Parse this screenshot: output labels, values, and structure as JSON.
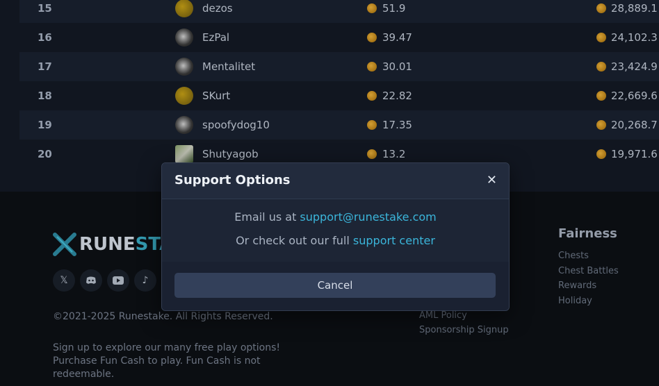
{
  "leaderboard": {
    "rows": [
      {
        "rank": "15",
        "user": "dezos",
        "wagered": "51.9",
        "prize": "28,889.1"
      },
      {
        "rank": "16",
        "user": "EzPal",
        "wagered": "39.47",
        "prize": "24,102.3"
      },
      {
        "rank": "17",
        "user": "Mentalitet",
        "wagered": "30.01",
        "prize": "23,424.9"
      },
      {
        "rank": "18",
        "user": "SKurt",
        "wagered": "22.82",
        "prize": "22,669.6"
      },
      {
        "rank": "19",
        "user": "spoofydog10",
        "wagered": "17.35",
        "prize": "20,268.7"
      },
      {
        "rank": "20",
        "user": "Shutyagob",
        "wagered": "13.2",
        "prize": "19,971.6"
      }
    ]
  },
  "footer": {
    "logo_prefix": "RUNE",
    "logo_suffix": "STA",
    "socials": [
      "x-icon",
      "discord-icon",
      "youtube-icon",
      "tiktok-icon"
    ],
    "copyright": "©2021-2025 Runestake. All Rights Reserved.",
    "promo_line1": "Sign up to explore our many free play options!",
    "promo_line2": "Purchase Fun Cash to play. Fun Cash is not",
    "promo_line3": "redeemable.",
    "links": {
      "aml": "AML Policy",
      "sponsorship": "Sponsorship Signup"
    },
    "fairness": {
      "title": "Fairness",
      "items": [
        "Chests",
        "Chest Battles",
        "Rewards",
        "Holiday"
      ]
    }
  },
  "modal": {
    "title": "Support Options",
    "email_prefix": "Email us at ",
    "email": "support@runestake.com",
    "support_prefix": "Or check out our full ",
    "support_link": "support center",
    "cancel_label": "Cancel"
  }
}
